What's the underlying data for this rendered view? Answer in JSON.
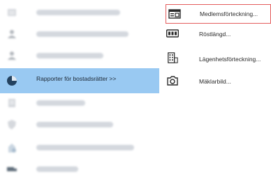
{
  "left_menu": {
    "selected_label": "Rapporter för bostadsrätter >>"
  },
  "submenu": {
    "items": [
      {
        "label": "Medlemsförteckning...",
        "icon": "member-register-icon"
      },
      {
        "label": "Röstlängd...",
        "icon": "vote-register-icon"
      },
      {
        "label": "Lägenhetsförteckning...",
        "icon": "apartment-register-icon"
      },
      {
        "label": "Mäklarbild...",
        "icon": "camera-icon"
      }
    ]
  },
  "colors": {
    "selected_bg": "#99c9f2",
    "highlight_border": "#e45b5b"
  }
}
